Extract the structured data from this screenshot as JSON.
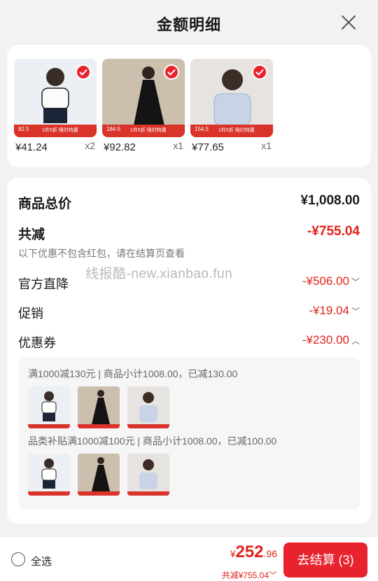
{
  "header": {
    "title": "金额明细"
  },
  "products": [
    {
      "tag_price": "82.5",
      "promo_text": "1件5折 限时特惠",
      "price": "¥41.24",
      "qty": "x2",
      "bg": "#eceff3"
    },
    {
      "tag_price": "184.5",
      "promo_text": "1件5折 限时特惠",
      "price": "¥92.82",
      "qty": "x1",
      "bg": "#cdbfae"
    },
    {
      "tag_price": "154.5",
      "promo_text": "1件5折 限时特惠",
      "price": "¥77.65",
      "qty": "x1",
      "bg": "#e6e3e0"
    }
  ],
  "detail": {
    "total_label": "商品总价",
    "total_value": "¥1,008.00",
    "reduce_label": "共减",
    "reduce_value": "-¥755.04",
    "hint": "以下优惠不包含红包，请在结算页查看",
    "watermark": "线报酷-new.xianbao.fun",
    "items": [
      {
        "label": "官方直降",
        "value": "-¥506.00",
        "chevron": "﹀"
      },
      {
        "label": "促销",
        "value": "-¥19.04",
        "chevron": "﹀"
      },
      {
        "label": "优惠券",
        "value": "-¥230.00",
        "chevron": "︿"
      }
    ],
    "coupons": [
      {
        "text": "满1000减130元 | 商品小计1008.00，已减130.00"
      },
      {
        "text": "品类补贴满1000减100元 | 商品小计1008.00，已减100.00"
      }
    ]
  },
  "bottom": {
    "select_all": "全选",
    "currency": "¥",
    "total_int": "252",
    "total_dec": ".96",
    "saved": "共减¥755.04﹀",
    "checkout": "去结算 (3)"
  },
  "colors": {
    "accent": "#e8232e",
    "discount": "#e2231a"
  }
}
